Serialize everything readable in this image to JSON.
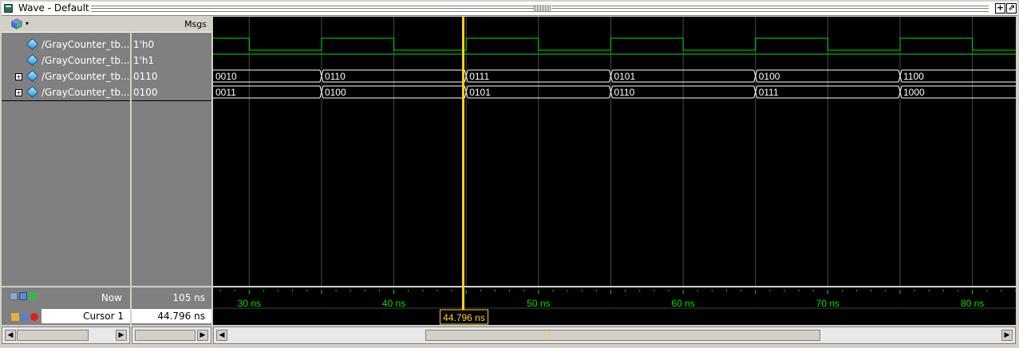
{
  "window": {
    "title": "Wave - Default"
  },
  "header": {
    "msgs_label": "Msgs"
  },
  "signals": [
    {
      "name": "/GrayCounter_tb...",
      "value": "1'h0",
      "expandable": false
    },
    {
      "name": "/GrayCounter_tb...",
      "value": "1'h1",
      "expandable": false
    },
    {
      "name": "/GrayCounter_tb...",
      "value": "0110",
      "expandable": true
    },
    {
      "name": "/GrayCounter_tb...",
      "value": "0100",
      "expandable": true
    }
  ],
  "waves": {
    "time_start_ns": 27.5,
    "time_end_ns": 83.0,
    "clk_edges_ns": [
      25,
      30,
      35,
      40,
      45,
      50,
      55,
      60,
      65,
      70,
      75,
      80,
      85
    ],
    "rst_high": true,
    "bus_a": {
      "segments": [
        {
          "start": 25,
          "label": "0010"
        },
        {
          "start": 35,
          "label": "0110"
        },
        {
          "start": 45,
          "label": "0111"
        },
        {
          "start": 55,
          "label": "0101"
        },
        {
          "start": 65,
          "label": "0100"
        },
        {
          "start": 75,
          "label": "1100"
        }
      ]
    },
    "bus_b": {
      "segments": [
        {
          "start": 25,
          "label": "0011"
        },
        {
          "start": 35,
          "label": "0100"
        },
        {
          "start": 45,
          "label": "0101"
        },
        {
          "start": 55,
          "label": "0110"
        },
        {
          "start": 65,
          "label": "0111"
        },
        {
          "start": 75,
          "label": "1000"
        }
      ]
    },
    "grid_ns": [
      30,
      35,
      40,
      45,
      50,
      55,
      60,
      65,
      70,
      75,
      80
    ],
    "ticks_ns": [
      30,
      40,
      50,
      60,
      70,
      80
    ],
    "tick_labels": [
      "30 ns",
      "40 ns",
      "50 ns",
      "60 ns",
      "70 ns",
      "80 ns"
    ],
    "cursor_ns": 44.796,
    "cursor_label": "44.796 ns",
    "colors": {
      "wave": "#00e000",
      "bus": "#ffffff",
      "grid": "#4a4a4a",
      "cursor": "#ffd21a",
      "ticklabel": "#00e000"
    }
  },
  "status": {
    "now_label": "Now",
    "now_value": "105 ns",
    "cursor_label": "Cursor 1",
    "cursor_value": "44.796 ns"
  }
}
